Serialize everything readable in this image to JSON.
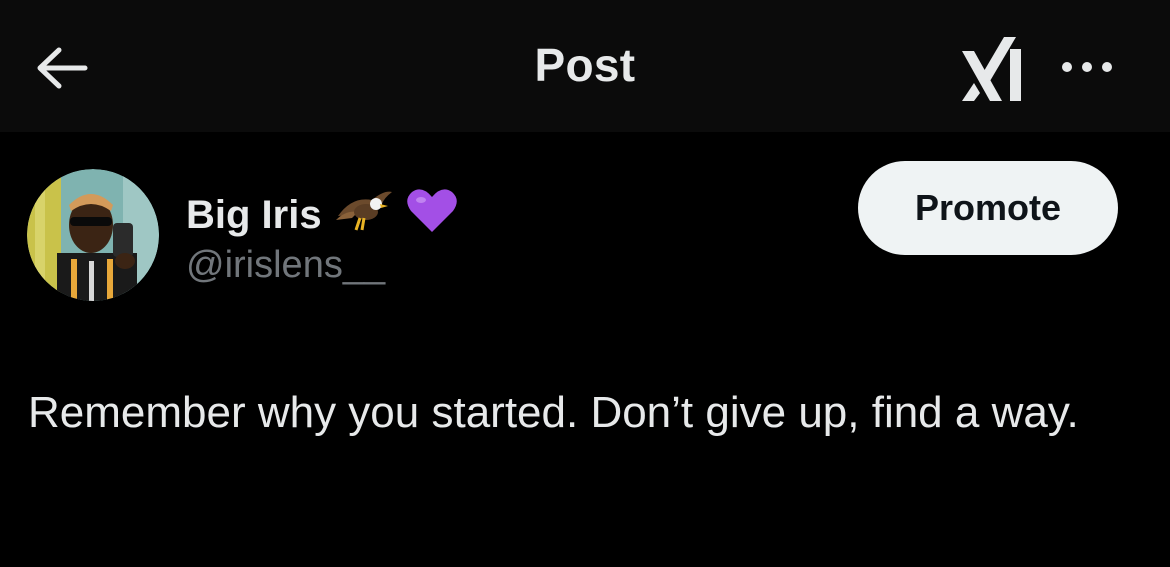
{
  "header": {
    "title": "Post",
    "back_icon": "arrow-left-icon",
    "grok_icon": "grok-icon",
    "more_icon": "more-horizontal-icon"
  },
  "author": {
    "name": "Big Iris",
    "name_emojis": [
      "eagle",
      "purple-heart"
    ],
    "handle": "@irislens__"
  },
  "promote_label": "Promote",
  "post": {
    "text": "Remember why you started. Don’t give up, find a way."
  },
  "colors": {
    "background": "#000000",
    "header_background": "#0b0b0b",
    "text_primary": "#e7e9ea",
    "text_secondary": "#71767b",
    "button_background": "#eff3f4",
    "heart": "#a34fe6"
  }
}
